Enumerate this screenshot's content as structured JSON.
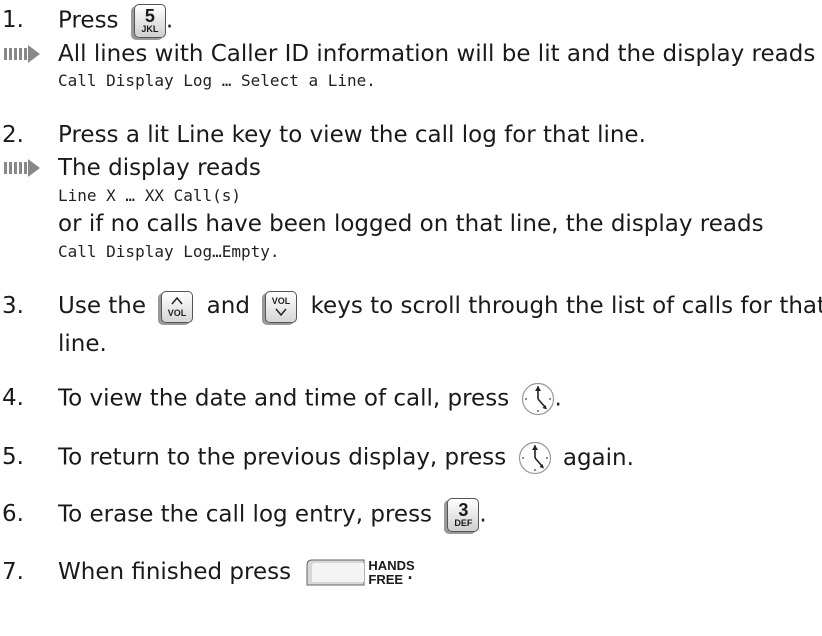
{
  "steps": [
    {
      "num": "1.",
      "before": "Press",
      "after": "."
    },
    {
      "num": "2.",
      "text": "Press a lit Line key to view the call log for that line."
    },
    {
      "num": "3.",
      "before": "Use the",
      "mid": "and",
      "after": "keys to scroll through the list of calls for that",
      "cont": "line."
    },
    {
      "num": "4.",
      "before": "To view the date and time of call, press",
      "after": "."
    },
    {
      "num": "5.",
      "before": "To return to the previous display, press",
      "after": "again."
    },
    {
      "num": "6.",
      "before": "To erase the call log entry, press",
      "after": "."
    },
    {
      "num": "7.",
      "before": "When finished press",
      "after": "."
    }
  ],
  "results": {
    "r1": {
      "text": "All lines with Caller ID information will be lit and the display reads",
      "display": "Call Display Log … Select a Line."
    },
    "r2": {
      "text": "The display reads",
      "display1": "Line X … XX Call(s)",
      "text2": "or if no calls have been logged on that line, the display reads",
      "display2": "Call Display Log…Empty."
    }
  },
  "keys": {
    "key5": {
      "digit": "5",
      "letters": "JKL"
    },
    "key3": {
      "digit": "3",
      "letters": "DEF"
    },
    "vol_up": {
      "label": "VOL"
    },
    "vol_down": {
      "label": "VOL"
    },
    "handsfree": {
      "line1": "HANDS",
      "line2": "FREE"
    }
  },
  "icons": [
    "result-arrow-icon",
    "clock-icon",
    "vol-up-key",
    "vol-down-key",
    "handsfree-key"
  ]
}
